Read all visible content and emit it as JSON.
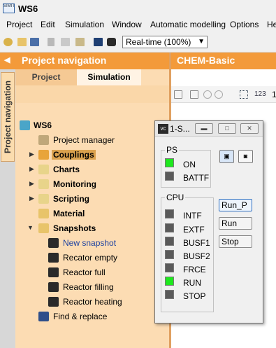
{
  "app": {
    "title": "WS6",
    "icon_text": "SIMIT"
  },
  "menu": [
    "Project",
    "Edit",
    "Simulation",
    "Window",
    "Automatic modelling",
    "Options",
    "He"
  ],
  "toolbar": {
    "icons": [
      "settings-icon",
      "open-folder-icon",
      "save-icon",
      "cut-icon",
      "copy-icon",
      "paste-icon",
      "stop-icon",
      "snapshot-icon"
    ],
    "speed_select": "Real-time (100%)"
  },
  "nav": {
    "title": "Project navigation",
    "collapse_arrow": "◀",
    "vertical_tab": "Project navigation",
    "tabs": [
      "Project",
      "Simulation"
    ],
    "active_tab": "Simulation",
    "tree": [
      {
        "label": "WS6",
        "icon": "project-icon",
        "expander": "",
        "bold": true
      },
      {
        "label": "Project manager",
        "icon": "project-manager-icon",
        "expander": "",
        "bold": false
      },
      {
        "label": "Couplings",
        "icon": "couplings-icon",
        "expander": "▶",
        "bold": true,
        "selected": true
      },
      {
        "label": "Charts",
        "icon": "charts-icon",
        "expander": "▶",
        "bold": true
      },
      {
        "label": "Monitoring",
        "icon": "monitoring-icon",
        "expander": "▶",
        "bold": true
      },
      {
        "label": "Scripting",
        "icon": "scripting-icon",
        "expander": "▶",
        "bold": true
      },
      {
        "label": "Material",
        "icon": "material-icon",
        "expander": "",
        "bold": true
      },
      {
        "label": "Snapshots",
        "icon": "snapshots-icon",
        "expander": "▼",
        "bold": true
      },
      {
        "label": "New snapshot",
        "icon": "camera-icon",
        "expander": "",
        "bold": false,
        "link": true
      },
      {
        "label": "Recator empty",
        "icon": "camera-icon",
        "expander": "",
        "bold": false
      },
      {
        "label": "Reactor full",
        "icon": "camera-icon",
        "expander": "",
        "bold": false
      },
      {
        "label": "Reactor filling",
        "icon": "camera-icon",
        "expander": "",
        "bold": false
      },
      {
        "label": "Reactor heating",
        "icon": "camera-icon",
        "expander": "",
        "bold": false
      },
      {
        "label": "Find & replace",
        "icon": "binoculars-icon",
        "expander": "",
        "bold": false
      }
    ]
  },
  "document": {
    "title": "CHEM-Basic",
    "toolbar_text": "123",
    "toolbar_more": "1"
  },
  "float_window": {
    "icon_text": "vc",
    "title": "1-S...",
    "ps": {
      "title": "PS",
      "leds": [
        {
          "label": "ON",
          "state": "on"
        },
        {
          "label": "BATTF",
          "state": "off"
        }
      ]
    },
    "cpu": {
      "title": "CPU",
      "leds": [
        {
          "label": "INTF",
          "state": "off"
        },
        {
          "label": "EXTF",
          "state": "off"
        },
        {
          "label": "BUSF1",
          "state": "off"
        },
        {
          "label": "BUSF2",
          "state": "off"
        },
        {
          "label": "FRCE",
          "state": "off"
        },
        {
          "label": "RUN",
          "state": "on"
        },
        {
          "label": "STOP",
          "state": "off"
        }
      ]
    },
    "buttons": [
      "Run_P",
      "Run",
      "Stop"
    ],
    "colors": {
      "led_on": "#1ee81e",
      "led_off": "#5a5a5a"
    }
  },
  "colors": {
    "accent": "#f39a3a",
    "nav_background": "#fcdcb3",
    "selection": "#dba24e",
    "link": "#1a3fa0"
  }
}
